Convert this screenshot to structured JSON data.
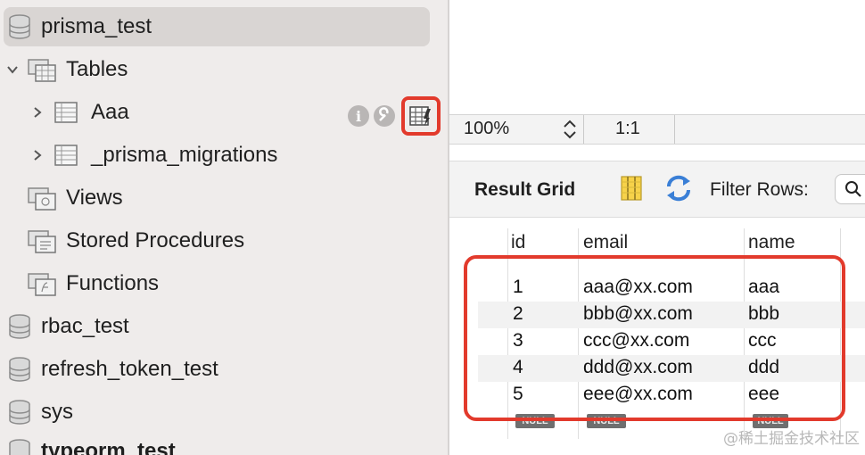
{
  "sidebar": {
    "schemas_top": {
      "label": "prisma_test"
    },
    "tables_folder": {
      "label": "Tables"
    },
    "tables": [
      {
        "label": "Aaa"
      },
      {
        "label": "_prisma_migrations"
      }
    ],
    "folders": [
      {
        "label": "Views"
      },
      {
        "label": "Stored Procedures"
      },
      {
        "label": "Functions"
      }
    ],
    "other_schemas": [
      {
        "label": "rbac_test"
      },
      {
        "label": "refresh_token_test"
      },
      {
        "label": "sys"
      },
      {
        "label": "typeorm_test"
      }
    ],
    "row_tools": {
      "info_glyph": "i"
    }
  },
  "zoom_bar": {
    "zoom": "100%",
    "ratio": "1:1"
  },
  "result_toolbar": {
    "title": "Result Grid",
    "filter_label": "Filter Rows:"
  },
  "grid": {
    "columns": [
      "id",
      "email",
      "name"
    ],
    "rows": [
      [
        "1",
        "aaa@xx.com",
        "aaa"
      ],
      [
        "2",
        "bbb@xx.com",
        "bbb"
      ],
      [
        "3",
        "ccc@xx.com",
        "ccc"
      ],
      [
        "4",
        "ddd@xx.com",
        "ddd"
      ],
      [
        "5",
        "eee@xx.com",
        "eee"
      ]
    ],
    "null_label": "NULL"
  },
  "watermark": "@稀土掘金技术社区",
  "colors": {
    "highlight": "#e23a2c",
    "sidebar_bg": "#efeceb"
  }
}
